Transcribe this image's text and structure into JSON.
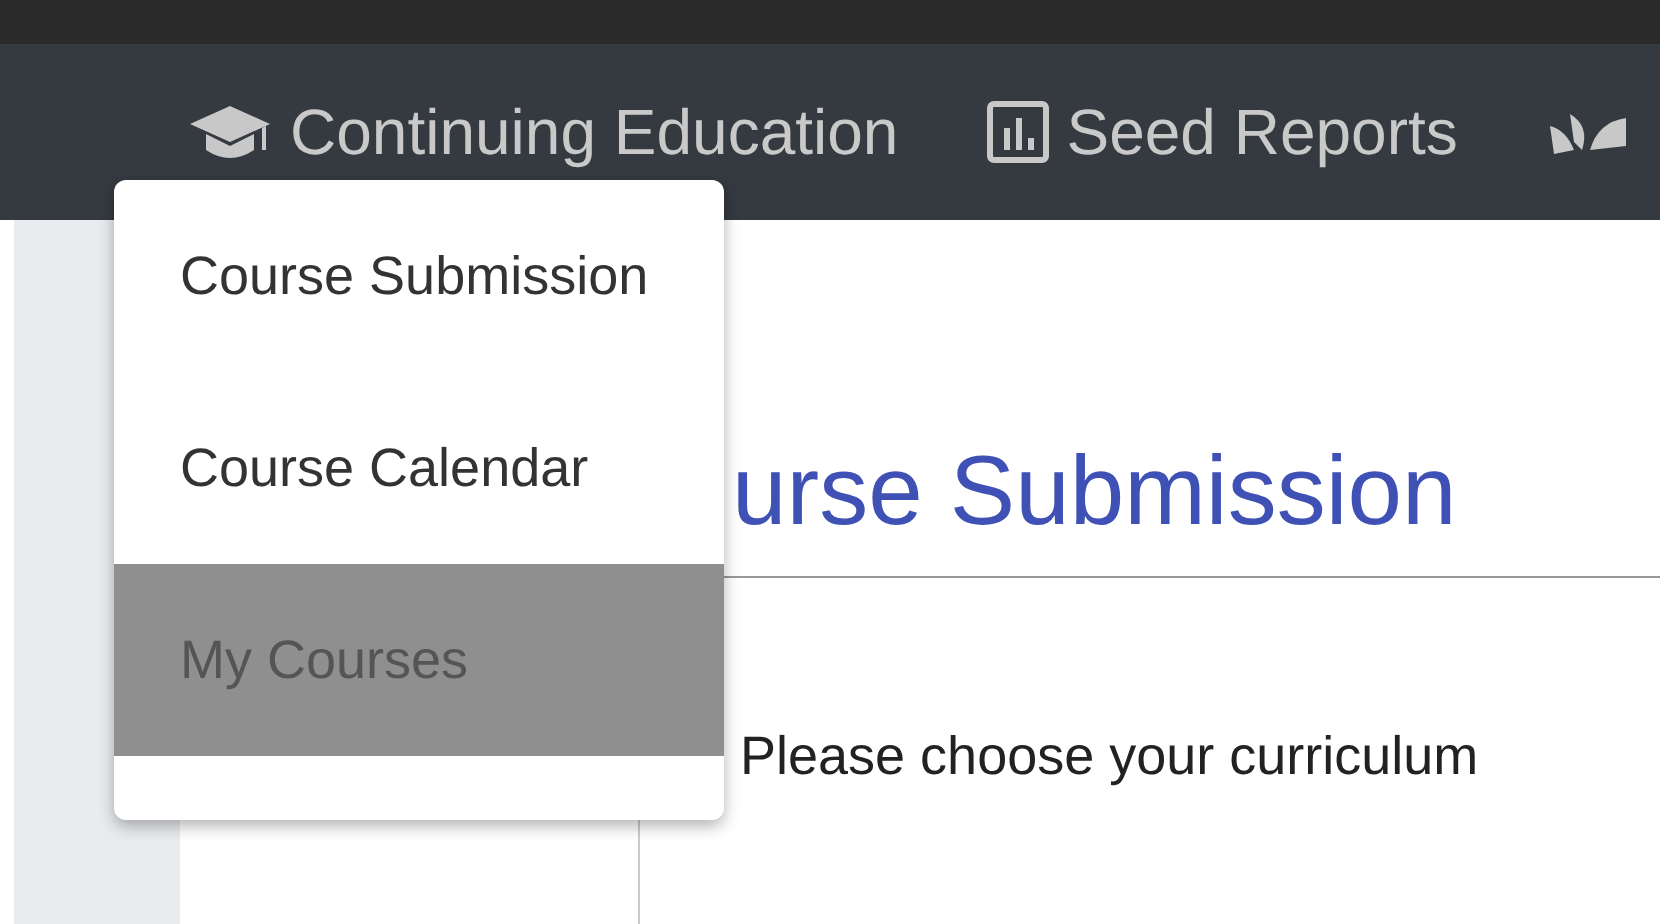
{
  "nav": {
    "items": [
      {
        "kind": "cap",
        "label": "Continuing Education"
      },
      {
        "kind": "chart",
        "label": "Seed Reports"
      },
      {
        "kind": "plant"
      }
    ]
  },
  "menu": {
    "items": [
      {
        "label": "Course Submission",
        "selected": false
      },
      {
        "label": "Course Calendar",
        "selected": false
      },
      {
        "label": "My Courses",
        "selected": true
      }
    ]
  },
  "page": {
    "heading": "urse Submission",
    "prompt": "Please choose your curriculum"
  }
}
